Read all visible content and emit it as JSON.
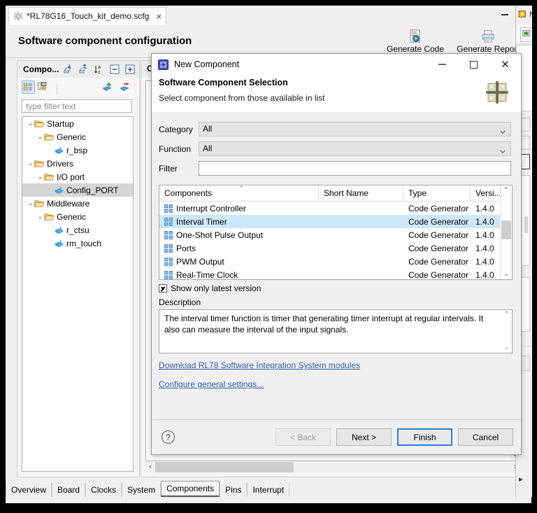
{
  "editor_tab": {
    "filename": "*RL78G16_Touch_kit_demo.scfg",
    "close": "×",
    "icon": "gear-icon"
  },
  "window": {
    "minimize": "minimize-icon",
    "maximize": "maximize-icon"
  },
  "page": {
    "title": "Software component configuration"
  },
  "toolbar": {
    "generate_code": "Generate Code",
    "generate_report": "Generate Report"
  },
  "components_panel": {
    "title": "Compo...",
    "filter_placeholder": "type filter text",
    "tools": [
      "import-icon",
      "export-icon",
      "sort-az-icon",
      "collapse-all-icon",
      "expand-all-icon"
    ],
    "tools2": [
      "component-view-icon",
      "hardware-view-icon",
      "add-component-icon",
      "remove-component-icon"
    ],
    "tree": [
      {
        "label": "Startup",
        "depth": 0,
        "kind": "folder",
        "twist": "⌄",
        "selected": false
      },
      {
        "label": "Generic",
        "depth": 1,
        "kind": "folder",
        "twist": "⌄",
        "selected": false
      },
      {
        "label": "r_bsp",
        "depth": 2,
        "kind": "comp",
        "twist": "",
        "selected": false
      },
      {
        "label": "Drivers",
        "depth": 0,
        "kind": "folder",
        "twist": "⌄",
        "selected": false
      },
      {
        "label": "I/O port",
        "depth": 1,
        "kind": "folder",
        "twist": "⌄",
        "selected": false
      },
      {
        "label": "Config_PORT",
        "depth": 2,
        "kind": "comp",
        "twist": "",
        "selected": true
      },
      {
        "label": "Middleware",
        "depth": 0,
        "kind": "folder",
        "twist": "⌄",
        "selected": false
      },
      {
        "label": "Generic",
        "depth": 1,
        "kind": "folder",
        "twist": "⌄",
        "selected": false
      },
      {
        "label": "r_ctsu",
        "depth": 2,
        "kind": "comp",
        "twist": "",
        "selected": false
      },
      {
        "label": "rm_touch",
        "depth": 2,
        "kind": "comp",
        "twist": "",
        "selected": false
      }
    ]
  },
  "middle_panel": {
    "title": "Co...",
    "scroll_left": "‹",
    "scroll_right": "›",
    "scroll_up": "⌃",
    "scroll_down": "⌄"
  },
  "bottom_tabs": [
    {
      "label": "Overview",
      "active": false
    },
    {
      "label": "Board",
      "active": false
    },
    {
      "label": "Clocks",
      "active": false
    },
    {
      "label": "System",
      "active": false
    },
    {
      "label": "Components",
      "active": true
    },
    {
      "label": "Pins",
      "active": false
    },
    {
      "label": "Interrupt",
      "active": false
    }
  ],
  "dialog": {
    "title": "New Component",
    "title_icon": "new-component-icon",
    "controls": {
      "minimize": "minimize-icon",
      "maximize": "maximize-icon",
      "close": "✕"
    },
    "heading": "Software Component Selection",
    "subheading": "Select component from those available in list",
    "logo": "component-grid-logo",
    "fields": [
      {
        "label": "Category",
        "value": "All",
        "type": "combo"
      },
      {
        "label": "Function",
        "value": "All",
        "type": "combo"
      },
      {
        "label": "Filter",
        "value": "",
        "type": "text"
      }
    ],
    "table": {
      "columns": [
        "Components",
        "Short Name",
        "Type",
        "Versi..."
      ],
      "sort_column": 0,
      "sort_mark": "⌃",
      "rows": [
        {
          "name": "Interrupt Controller",
          "short_name": "",
          "type": "Code Generator",
          "version": "1.4.0",
          "selected": false
        },
        {
          "name": "Interval Timer",
          "short_name": "",
          "type": "Code Generator",
          "version": "1.4.0",
          "selected": true
        },
        {
          "name": "One-Shot Pulse Output",
          "short_name": "",
          "type": "Code Generator",
          "version": "1.4.0",
          "selected": false
        },
        {
          "name": "Ports",
          "short_name": "",
          "type": "Code Generator",
          "version": "1.4.0",
          "selected": false
        },
        {
          "name": "PWM Output",
          "short_name": "",
          "type": "Code Generator",
          "version": "1.4.0",
          "selected": false
        },
        {
          "name": "Real-Time Clock",
          "short_name": "",
          "type": "Code Generator",
          "version": "1.4.0",
          "selected": false
        }
      ],
      "scroll_up": "⌃",
      "scroll_down": "⌄"
    },
    "show_only_latest": {
      "label": "Show only latest version",
      "checked": true
    },
    "description_label": "Description",
    "description_text": "The interval timer function is timer that generating timer interrupt at regular intervals. It also can measure the interval of the input signals.",
    "links": [
      "Download RL78 Software Integration System modules",
      "Configure general settings..."
    ],
    "help": "?",
    "buttons": [
      {
        "label": "< Back",
        "state": "disabled"
      },
      {
        "label": "Next >",
        "state": "normal"
      },
      {
        "label": "Finish",
        "state": "default"
      },
      {
        "label": "Cancel",
        "state": "normal"
      }
    ]
  },
  "colors": {
    "selection_blue": "#cde8fb",
    "link_blue": "#2f5fa8",
    "default_button_border": "#2f7fd1",
    "tree_selection": "#d6d6d6"
  }
}
